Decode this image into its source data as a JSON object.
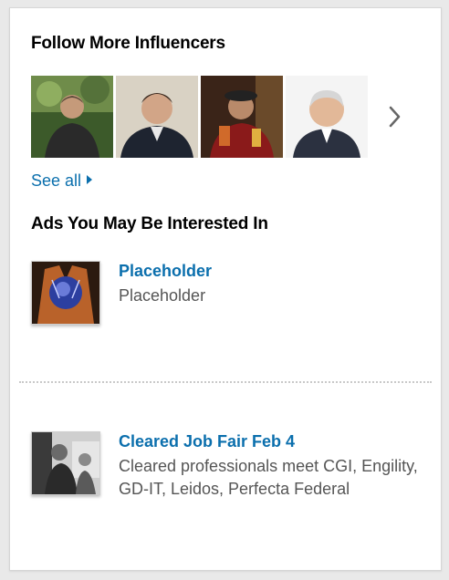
{
  "influencers": {
    "title": "Follow More Influencers",
    "people_count": 4,
    "see_all_label": "See all",
    "next_icon": "chevron-right-icon"
  },
  "ads": {
    "title": "Ads You May Be Interested In",
    "items": [
      {
        "title": "Placeholder",
        "description": "Placeholder"
      },
      {
        "title": "Cleared Job Fair Feb 4",
        "description": "Cleared professionals meet CGI, Engility, GD-IT, Leidos, Perfecta Federal"
      }
    ]
  },
  "colors": {
    "link": "#0b6fad",
    "description": "#555555",
    "background": "#e9e9e9",
    "card": "#ffffff"
  }
}
